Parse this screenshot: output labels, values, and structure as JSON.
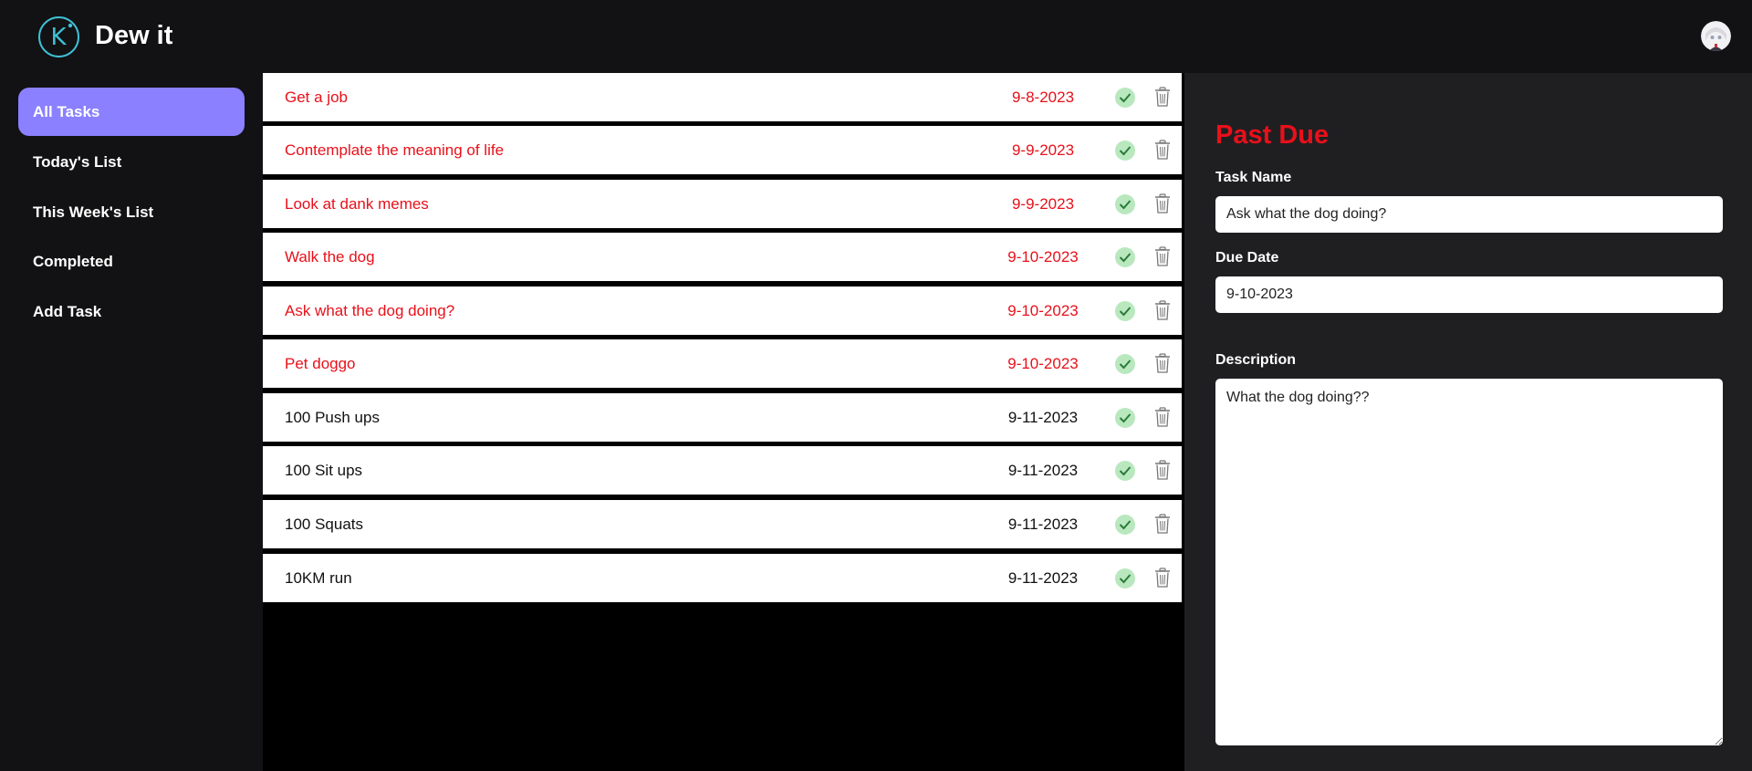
{
  "app": {
    "title": "Dew it",
    "logo_letter": "K"
  },
  "sidebar": {
    "items": [
      {
        "label": "All Tasks",
        "active": true
      },
      {
        "label": "Today's List",
        "active": false
      },
      {
        "label": "This Week's List",
        "active": false
      },
      {
        "label": "Completed",
        "active": false
      },
      {
        "label": "Add Task",
        "active": false
      }
    ]
  },
  "tasks": [
    {
      "name": "Get a job",
      "date": "9-8-2023",
      "overdue": true
    },
    {
      "name": "Contemplate the meaning of life",
      "date": "9-9-2023",
      "overdue": true
    },
    {
      "name": "Look at dank memes",
      "date": "9-9-2023",
      "overdue": true
    },
    {
      "name": "Walk the dog",
      "date": "9-10-2023",
      "overdue": true
    },
    {
      "name": "Ask what the dog doing?",
      "date": "9-10-2023",
      "overdue": true
    },
    {
      "name": "Pet doggo",
      "date": "9-10-2023",
      "overdue": true
    },
    {
      "name": "100 Push ups",
      "date": "9-11-2023",
      "overdue": false
    },
    {
      "name": "100 Sit ups",
      "date": "9-11-2023",
      "overdue": false
    },
    {
      "name": "100 Squats",
      "date": "9-11-2023",
      "overdue": false
    },
    {
      "name": "10KM run",
      "date": "9-11-2023",
      "overdue": false
    }
  ],
  "detail": {
    "status": "Past Due",
    "task_name_label": "Task Name",
    "task_name_value": "Ask what the dog doing?",
    "due_date_label": "Due Date",
    "due_date_value": "9-10-2023",
    "description_label": "Description",
    "description_value": "What the dog doing??"
  },
  "colors": {
    "accent": "#8b80ff",
    "overdue": "#e8101a",
    "check": "#b9e8bf",
    "logo": "#3fc1d6"
  },
  "icons": {
    "logo": "k-logo-icon",
    "check": "checkmark-icon",
    "delete": "trash-icon",
    "avatar": "user-avatar"
  }
}
